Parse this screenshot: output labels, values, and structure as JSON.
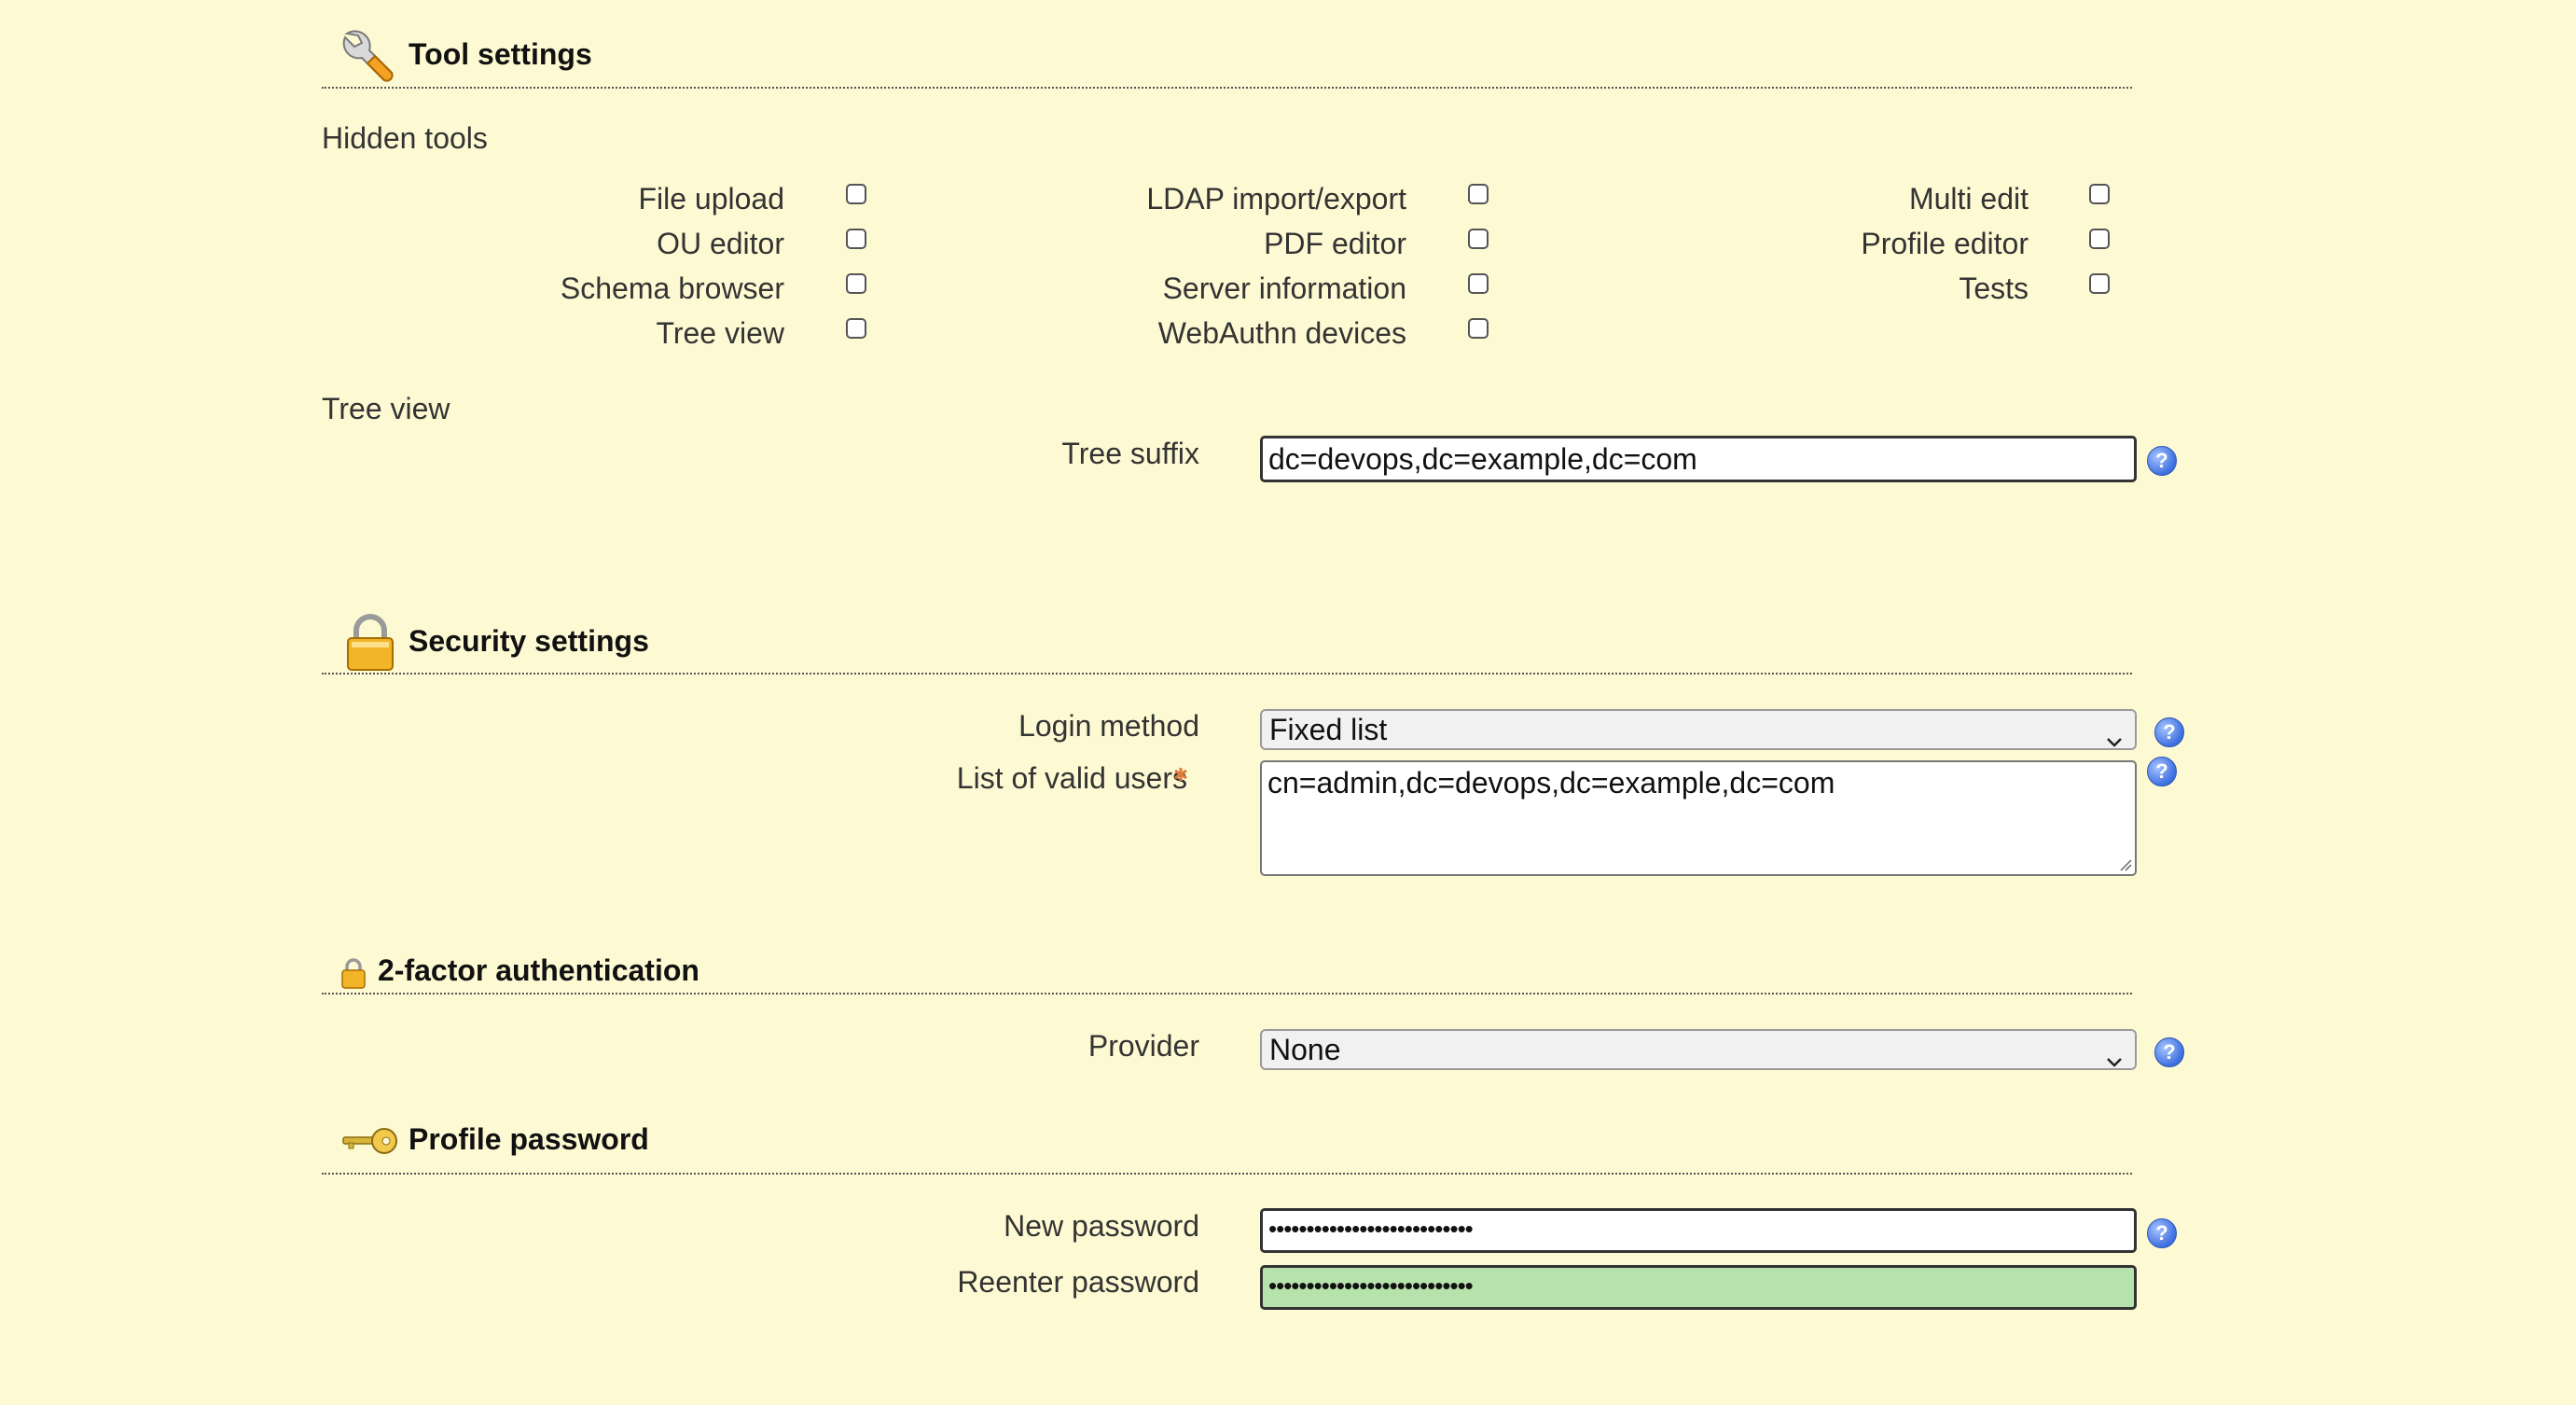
{
  "tool_settings": {
    "title": "Tool settings",
    "hidden_tools_label": "Hidden tools",
    "tools": [
      {
        "label": "File upload",
        "checked": false
      },
      {
        "label": "OU editor",
        "checked": false
      },
      {
        "label": "Schema browser",
        "checked": false
      },
      {
        "label": "Tree view",
        "checked": false
      },
      {
        "label": "LDAP import/export",
        "checked": false
      },
      {
        "label": "PDF editor",
        "checked": false
      },
      {
        "label": "Server information",
        "checked": false
      },
      {
        "label": "WebAuthn devices",
        "checked": false
      },
      {
        "label": "Multi edit",
        "checked": false
      },
      {
        "label": "Profile editor",
        "checked": false
      },
      {
        "label": "Tests",
        "checked": false
      }
    ],
    "tree_view_label": "Tree view",
    "tree_suffix_label": "Tree suffix",
    "tree_suffix_value": "dc=devops,dc=example,dc=com"
  },
  "security_settings": {
    "title": "Security settings",
    "login_method_label": "Login method",
    "login_method_value": "Fixed list",
    "valid_users_label": "List of valid users",
    "valid_users_value": "cn=admin,dc=devops,dc=example,dc=com"
  },
  "two_factor": {
    "title": "2-factor authentication",
    "provider_label": "Provider",
    "provider_value": "None"
  },
  "profile_password": {
    "title": "Profile password",
    "new_password_label": "New password",
    "new_password_value": "•••••••••••••••••••••••••••",
    "reenter_password_label": "Reenter password",
    "reenter_password_value": "•••••••••••••••••••••••••••",
    "match_color": "#b6e3ac"
  },
  "help_icon_text": "?"
}
